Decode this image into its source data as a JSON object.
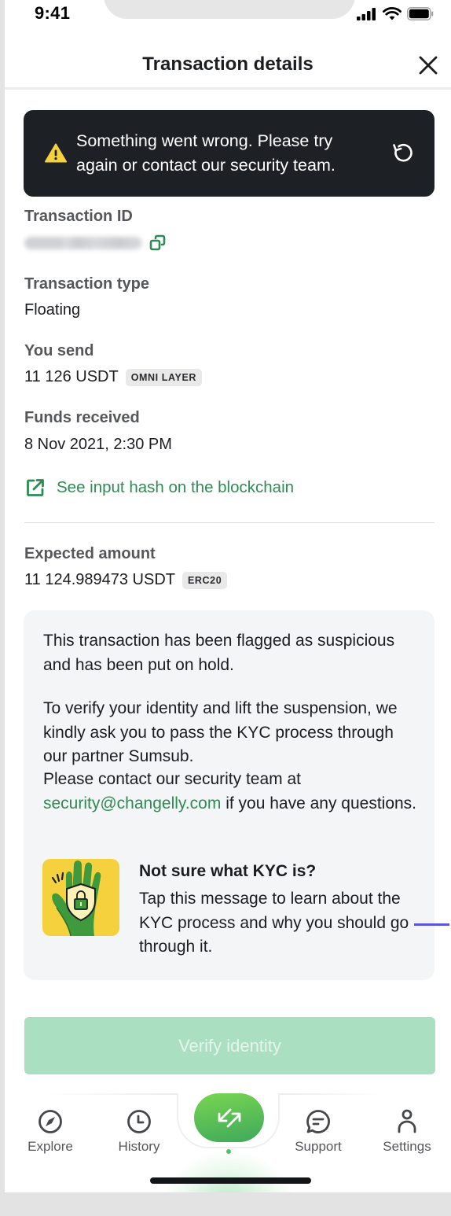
{
  "status_bar": {
    "time": "9:41",
    "icons": [
      "cellular-signal-icon",
      "wifi-icon",
      "battery-icon"
    ]
  },
  "header": {
    "title": "Transaction details",
    "close_icon": "close-icon"
  },
  "error_banner": {
    "icon": "warning-icon",
    "message": "Something went wrong. Please try again or contact our security team.",
    "retry_icon": "retry-icon",
    "colors": {
      "background": "#1d2024",
      "warning": "#f5d23d"
    }
  },
  "details": {
    "transaction_id": {
      "label": "Transaction ID",
      "value_hidden": true,
      "copy_icon": "copy-icon"
    },
    "transaction_type": {
      "label": "Transaction type",
      "value": "Floating"
    },
    "you_send": {
      "label": "You send",
      "value": "11 126 USDT",
      "badge": "OMNI LAYER"
    },
    "funds_received": {
      "label": "Funds received",
      "value": "8 Nov 2021, 2:30 PM"
    },
    "blockchain_link": {
      "label": "See input hash on the blockchain",
      "icon": "external-link-icon"
    },
    "expected_amount": {
      "label": "Expected amount",
      "value": "11 124.989473 USDT",
      "badge": "ERC20"
    }
  },
  "info_box": {
    "paragraph_1": "This transaction has been flagged as suspicious and has been put on hold.",
    "paragraph_2": "To verify your identity and lift the suspension, we kindly ask you to pass the KYC process through our partner Sumsub.",
    "paragraph_3_prefix": "Please contact our security team at ",
    "email": "security@changelly.com",
    "paragraph_3_suffix": " if you have any questions.",
    "kyc_card": {
      "image": "hand-shield-lock-illustration",
      "title": "Not sure what KYC is?",
      "text": "Tap this message to learn about the KYC process and why you should go through it."
    }
  },
  "verify_button": {
    "label": "Verify identity",
    "disabled": true
  },
  "bottom_nav": {
    "items": [
      {
        "label": "Explore",
        "icon": "compass-icon"
      },
      {
        "label": "History",
        "icon": "clock-icon"
      },
      {
        "label": "",
        "icon": "exchange-arrows-icon",
        "active": true
      },
      {
        "label": "Support",
        "icon": "chat-bubble-icon"
      },
      {
        "label": "Settings",
        "icon": "user-icon"
      }
    ]
  },
  "colors": {
    "accent_green": "#2d8c52",
    "button_disabled": "#abdfc1",
    "exchange_gradient_start": "#78d650",
    "exchange_gradient_end": "#3fa85c"
  }
}
